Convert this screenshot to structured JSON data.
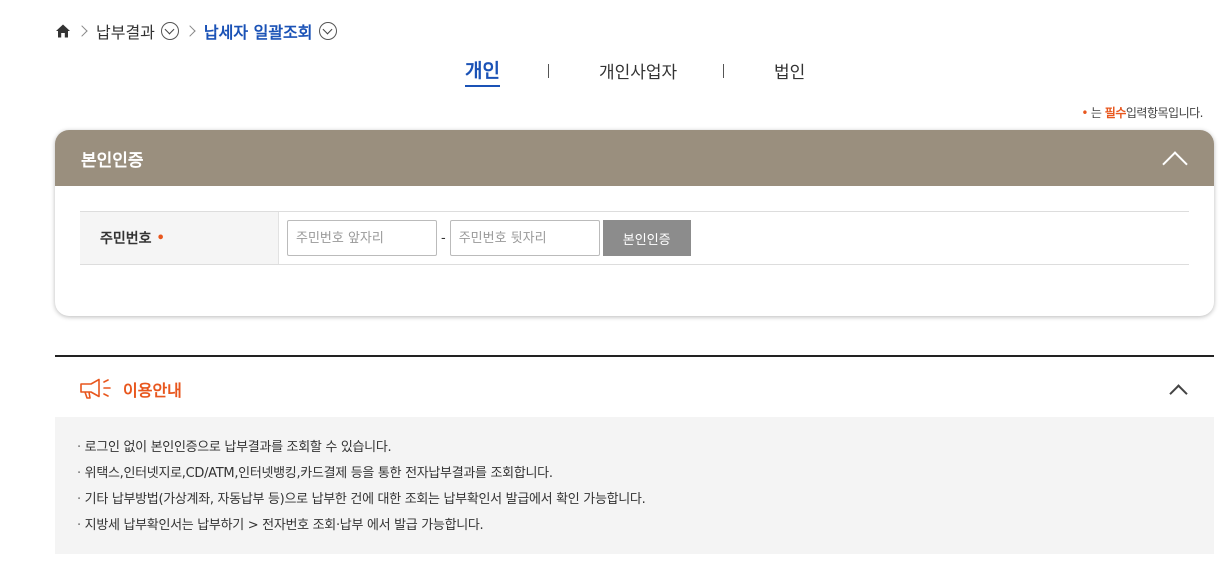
{
  "breadcrumb": {
    "items": [
      {
        "label": "납부결과"
      },
      {
        "label": "납세자 일괄조회"
      }
    ]
  },
  "tabs": [
    {
      "label": "개인",
      "active": true
    },
    {
      "label": "개인사업자",
      "active": false
    },
    {
      "label": "법인",
      "active": false
    }
  ],
  "required_note": {
    "dot": "•",
    "prefix": "는",
    "strong": "필수",
    "suffix": "입력항목입니다."
  },
  "verify_panel": {
    "title": "본인인증",
    "field_label": "주민번호",
    "required_dot": "•",
    "front_placeholder": "주민번호 앞자리",
    "back_placeholder": "주민번호 뒷자리",
    "separator": "-",
    "button_label": "본인인증"
  },
  "info": {
    "title": "이용안내",
    "items": [
      "로그인 없이 본인인증으로 납부결과를 조회할 수 있습니다.",
      "위택스,인터넷지로,CD/ATM,인터넷뱅킹,카드결제 등을 통한 전자납부결과를 조회합니다.",
      "기타 납부방법(가상계좌, 자동납부 등)으로 납부한 건에 대한 조회는 납부확인서 발급에서 확인 가능합니다.",
      "지방세 납부확인서는 납부하기 > 전자번호 조회·납부 에서 발급 가능합니다."
    ]
  },
  "colors": {
    "accent_blue": "#1a52b6",
    "accent_orange": "#e8571e",
    "panel_header": "#9a8f7e",
    "button_gray": "#8c8c8c"
  }
}
